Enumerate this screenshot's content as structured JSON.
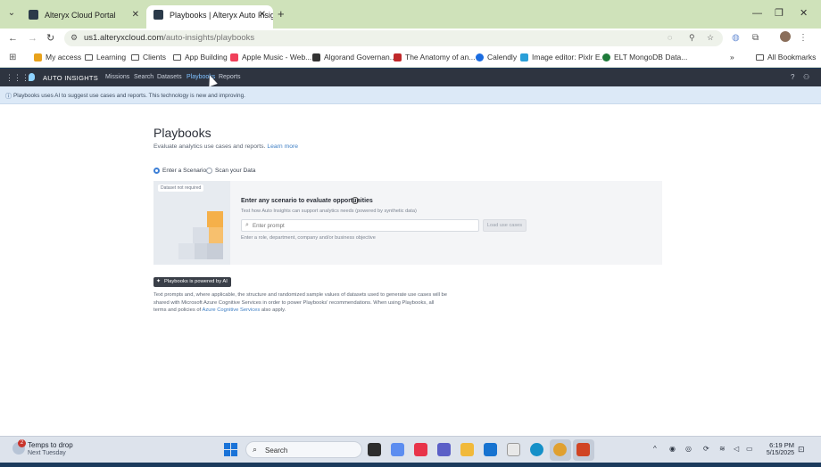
{
  "browser": {
    "tabs": [
      {
        "title": "Alteryx Cloud Portal",
        "close": "✕"
      },
      {
        "title": "Playbooks | Alteryx Auto Insight",
        "close": "✕"
      }
    ],
    "url_domain": "us1.alteryxcloud.com",
    "url_path": "/auto-insights/playbooks",
    "bookmarks": [
      "My access",
      "Learning",
      "Clients",
      "App Building",
      "Apple Music - Web...",
      "Algorand Governan...",
      "The Anatomy of an...",
      "Calendly",
      "Image editor: Pixlr E...",
      "ELT MongoDB Data..."
    ],
    "all_bookmarks": "All Bookmarks",
    "more_bookmarks": "»"
  },
  "app": {
    "brand": "AUTO INSIGHTS",
    "nav": [
      "Missions",
      "Search",
      "Datasets",
      "Playbooks",
      "Reports"
    ],
    "active_nav": "Playbooks",
    "banner": "Playbooks uses AI to suggest use cases and reports. This technology is new and improving."
  },
  "main": {
    "title": "Playbooks",
    "subtitle": "Evaluate analytics use cases and reports.",
    "learn_more": "Learn more",
    "radio_options": [
      "Enter a Scenario",
      "Scan your Data"
    ],
    "selected_option": "Enter a Scenario",
    "card": {
      "badge": "Dataset not required",
      "heading": "Enter any scenario to evaluate opportunities",
      "description": "Test how Auto Insights can support analytics needs (powered by synthetic data)",
      "prompt_placeholder": "Enter prompt",
      "load_button": "Load use cases",
      "hint": "Enter a role, department, company and/or business objective"
    },
    "ai_badge": "Playbooks is powered by AI",
    "disclaimer_pre": "Text prompts and, where applicable, the structure and randomized sample values of datasets used to generate use cases will be shared with Microsoft Azure Cognitive Services in order to power Playbooks' recommendations. When using Playbooks, all terms and policies of",
    "disclaimer_link": "Azure Cognitive Services",
    "disclaimer_post": "also apply."
  },
  "taskbar": {
    "weather_badge": "2",
    "weather_title": "Temps to drop",
    "weather_sub": "Next Tuesday",
    "search": "Search",
    "time": "6:19 PM",
    "date": "5/15/2025"
  }
}
